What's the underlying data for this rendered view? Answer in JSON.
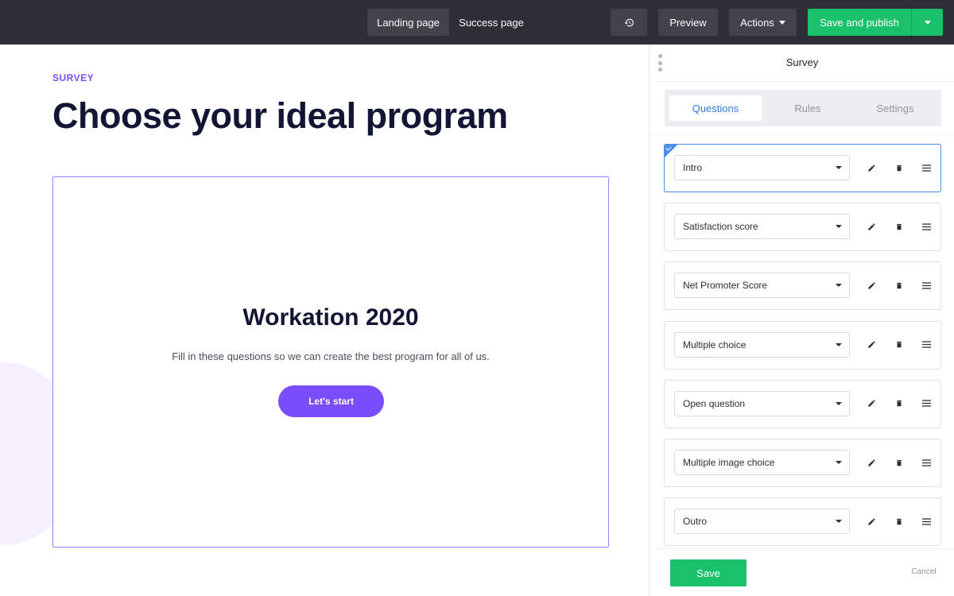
{
  "topbar": {
    "landing_label": "Landing page",
    "success_label": "Success page",
    "history_icon": "history-icon",
    "preview_label": "Preview",
    "actions_label": "Actions",
    "publish_label": "Save and publish"
  },
  "canvas": {
    "eyebrow": "SURVEY",
    "heading": "Choose your ideal program",
    "card": {
      "title": "Workation 2020",
      "subtitle": "Fill in these questions so we can create the best program for all of us.",
      "button_label": "Let's start"
    }
  },
  "panel": {
    "title": "Survey",
    "tabs": [
      {
        "label": "Questions",
        "active": true
      },
      {
        "label": "Rules",
        "active": false
      },
      {
        "label": "Settings",
        "active": false
      }
    ],
    "questions": [
      {
        "value": "Intro",
        "selected": true
      },
      {
        "value": "Satisfaction score",
        "selected": false
      },
      {
        "value": "Net Promoter Score",
        "selected": false
      },
      {
        "value": "Multiple choice",
        "selected": false
      },
      {
        "value": "Open question",
        "selected": false
      },
      {
        "value": "Multiple image choice",
        "selected": false
      },
      {
        "value": "Outro",
        "selected": false
      }
    ],
    "save_label": "Save",
    "cancel_label": "Cancel"
  },
  "colors": {
    "topbar_bg": "#2c2f35",
    "accent_green": "#19c26a",
    "accent_purple": "#7a4dfa",
    "tab_active_text": "#2f7fd6",
    "selected_border": "#4a8ee8"
  }
}
